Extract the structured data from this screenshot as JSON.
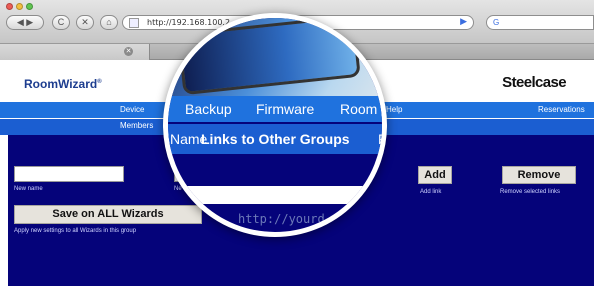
{
  "browser": {
    "url": "http://192.168.100.2",
    "back_glyph": "◀",
    "forward_glyph": "▶",
    "reload_glyph": "C",
    "stop_glyph": "✕",
    "home_glyph": "⌂",
    "go_glyph": "▶",
    "search_prefix": "G",
    "tab_close_glyph": "✕"
  },
  "header": {
    "app_logo": "RoomWizard",
    "app_logo_mark": "®",
    "brand_logo": "Steelcase"
  },
  "nav": {
    "primary": [
      "Device",
      "Backup",
      "Firmware",
      "Room",
      "Help",
      "Reservations"
    ],
    "secondary": [
      "Members",
      "Name",
      "Links to Other Groups",
      "F"
    ]
  },
  "form": {
    "new_name_label": "New name",
    "second_field_label": "Ne",
    "add_button": "Add",
    "add_link_label": "Add link",
    "remove_button": "Remove",
    "remove_selected_label": "Remove selected links",
    "save_all_button": "Save on ALL Wizards",
    "save_all_hint": "Apply new settings to all Wizards in this group",
    "url_placeholder": "http://yourd"
  },
  "colors": {
    "nav_primary": "#1f72de",
    "nav_secondary": "#1b5ed1",
    "panel": "#05037a"
  },
  "icons": [
    "back-icon",
    "forward-icon",
    "reload-icon",
    "stop-icon",
    "home-icon",
    "page-icon",
    "go-icon",
    "google-icon",
    "tab-close-icon"
  ]
}
